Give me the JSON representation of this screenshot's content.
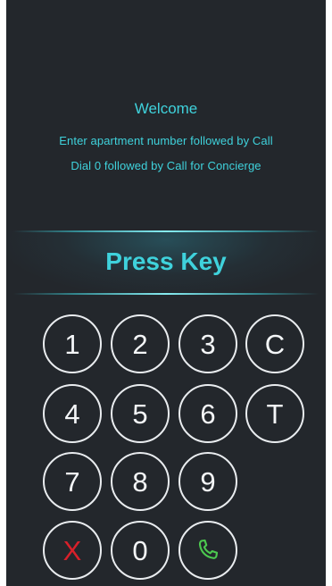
{
  "welcome": {
    "title": "Welcome",
    "line1": "Enter apartment number followed by Call",
    "line2": "Dial 0 followed by Call for Concierge"
  },
  "press_key": "Press Key",
  "keypad": {
    "k1": "1",
    "k2": "2",
    "k3": "3",
    "kC": "C",
    "k4": "4",
    "k5": "5",
    "k6": "6",
    "kT": "T",
    "k7": "7",
    "k8": "8",
    "k9": "9",
    "kX": "X",
    "k0": "0",
    "call_icon": "phone-handset-icon"
  },
  "colors": {
    "accent": "#3fd2dc",
    "background": "#23272c",
    "cancel": "#d8202a",
    "call": "#4cc94f"
  }
}
